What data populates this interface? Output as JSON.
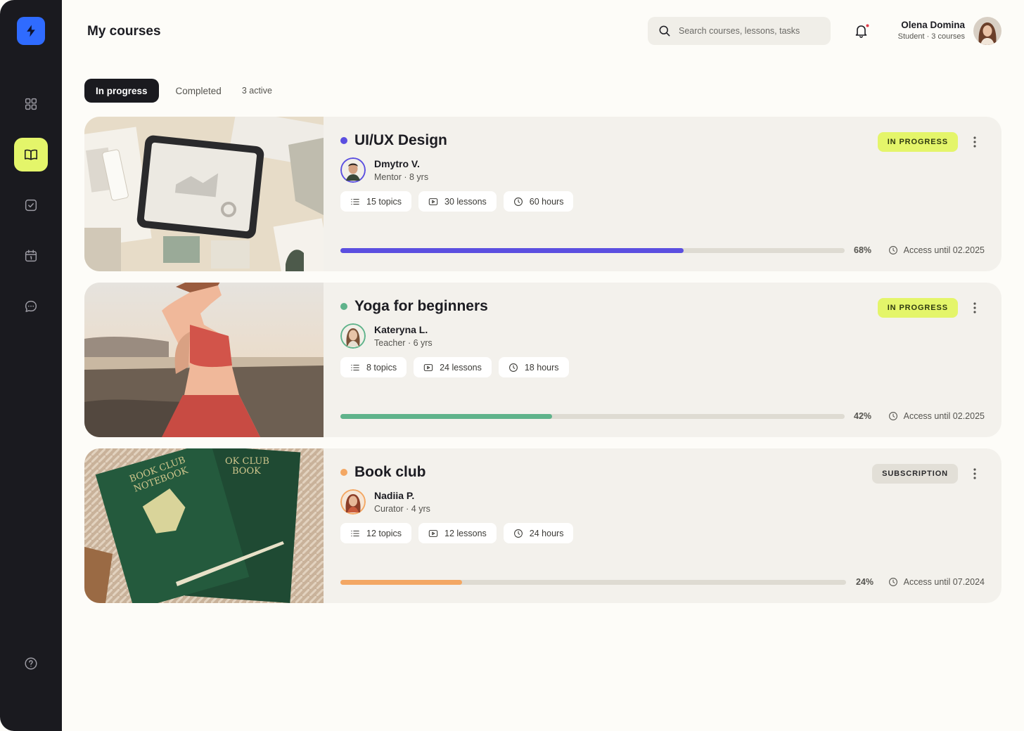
{
  "header": {
    "title": "My courses",
    "search_placeholder": "Search courses, lessons, tasks",
    "user_name": "Olena Domina",
    "user_subtitle": "Student · 3 courses"
  },
  "tabs": {
    "active": "In progress",
    "other": "Completed",
    "count": "3 active"
  },
  "colors": {
    "accent": "#e4f56a",
    "brand_blue": "#2f6bff",
    "sidebar": "#1a1a1f"
  },
  "courses": [
    {
      "title": "UI/UX Design",
      "dot_color": "#5b4fe0",
      "mentor": "Dmytro V.",
      "role": "Mentor · 8 yrs",
      "topics": "15 topics",
      "lessons": "30 lessons",
      "hours": "60 hours",
      "badge": "IN PROGRESS",
      "progress": 0.68,
      "progress_label": "68%",
      "access": "Access until 02.2025",
      "bar_color": "#5b4fe0"
    },
    {
      "title": "Yoga for beginners",
      "dot_color": "#5fb38b",
      "mentor": "Kateryna L.",
      "role": "Teacher · 6 yrs",
      "topics": "8 topics",
      "lessons": "24 lessons",
      "hours": "18 hours",
      "badge": "IN PROGRESS",
      "progress": 0.42,
      "progress_label": "42%",
      "access": "Access until 02.2025",
      "bar_color": "#5fb38b"
    },
    {
      "title": "Book club",
      "dot_color": "#f3a763",
      "mentor": "Nadiia P.",
      "role": "Curator · 4 yrs",
      "topics": "12 topics",
      "lessons": "12 lessons",
      "hours": "24 hours",
      "badge": "SUBSCRIPTION",
      "progress": 0.24,
      "progress_label": "24%",
      "access": "Access until 07.2024",
      "bar_color": "#f3a763"
    }
  ],
  "book_cover": {
    "line1": "BOOK CLUB",
    "line2": "NOTEBOOK",
    "line3": "OK CLUB",
    "line4": "BOOK"
  }
}
